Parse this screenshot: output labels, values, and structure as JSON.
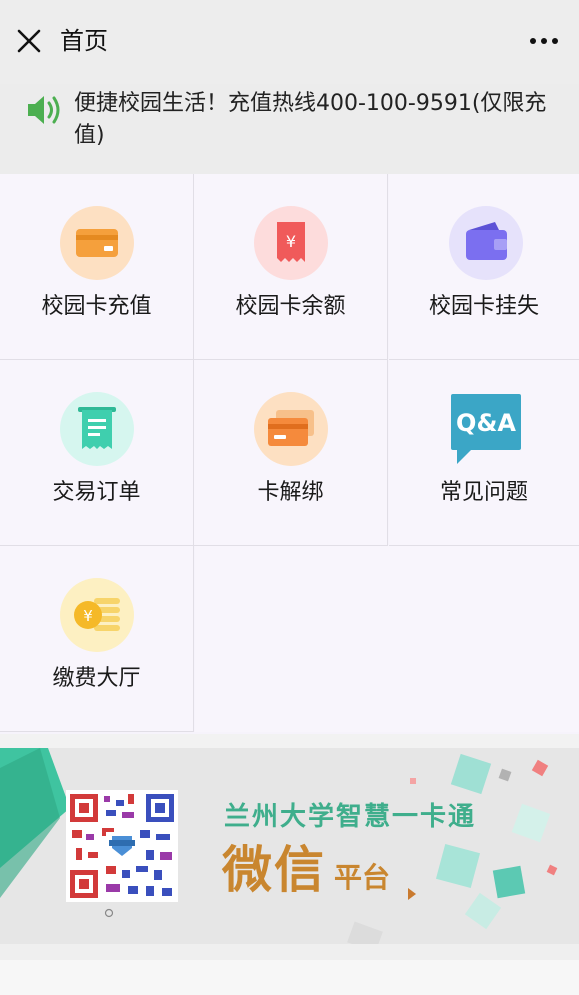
{
  "header": {
    "title": "首页",
    "close_icon": "close-icon",
    "more_icon": "more-icon"
  },
  "notice": {
    "text": "便捷校园生活！充值热线400-100-9591(仅限充值)",
    "icon": "speaker-icon"
  },
  "grid": {
    "items": [
      {
        "label": "校园卡充值",
        "icon": "card-recharge-icon"
      },
      {
        "label": "校园卡余额",
        "icon": "balance-receipt-icon"
      },
      {
        "label": "校园卡挂失",
        "icon": "wallet-icon"
      },
      {
        "label": "交易订单",
        "icon": "order-receipt-icon"
      },
      {
        "label": "卡解绑",
        "icon": "cards-unbind-icon"
      },
      {
        "label": "常见问题",
        "icon": "faq-qa-icon"
      },
      {
        "label": "缴费大厅",
        "icon": "payment-coin-icon"
      }
    ]
  },
  "banner": {
    "title": "兰州大学智慧一卡通",
    "big_text": "微信",
    "small_text": "平台",
    "qr_icon": "qr-code-icon"
  },
  "colors": {
    "orange": "#f5a03c",
    "red": "#f05a5a",
    "purple": "#7b6ff0",
    "teal": "#3fcfae",
    "qa_blue": "#3ba6c6",
    "gold": "#f5b928",
    "speaker_green": "#4caf50"
  }
}
